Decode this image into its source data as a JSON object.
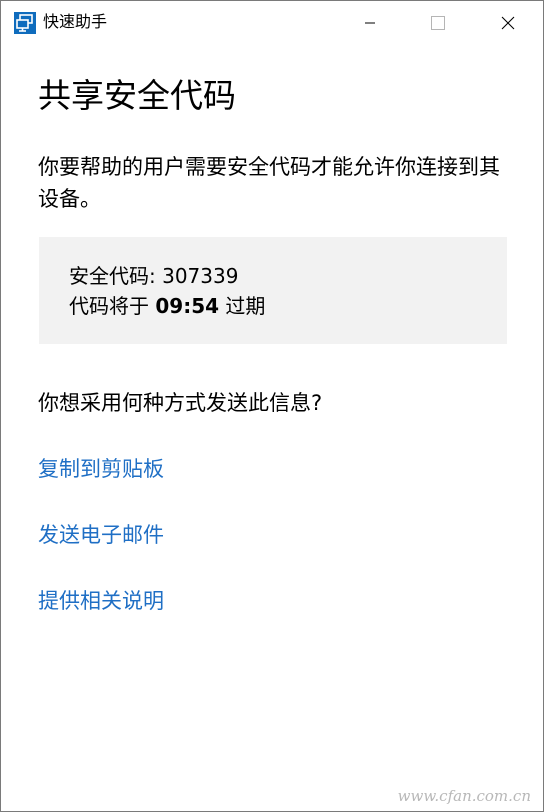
{
  "window": {
    "title": "快速助手",
    "app_icon": "remote-screen-icon",
    "controls": {
      "minimize_icon": "minimize-icon",
      "maximize_icon": "maximize-icon",
      "close_icon": "close-icon"
    }
  },
  "main": {
    "heading": "共享安全代码",
    "description": "你要帮助的用户需要安全代码才能允许你连接到其设备。",
    "code_box": {
      "code_label": "安全代码:",
      "code_value": "307339",
      "expiry_prefix": "代码将于",
      "expiry_time": "09:54",
      "expiry_suffix": "过期"
    },
    "question": "你想采用何种方式发送此信息?",
    "links": {
      "copy": "复制到剪贴板",
      "email": "发送电子邮件",
      "instructions": "提供相关说明"
    }
  },
  "watermark": "www.cfan.com.cn",
  "colors": {
    "accent_link": "#1f6fc5",
    "icon_blue": "#0f6cbd",
    "code_box_bg": "#f2f2f2"
  }
}
